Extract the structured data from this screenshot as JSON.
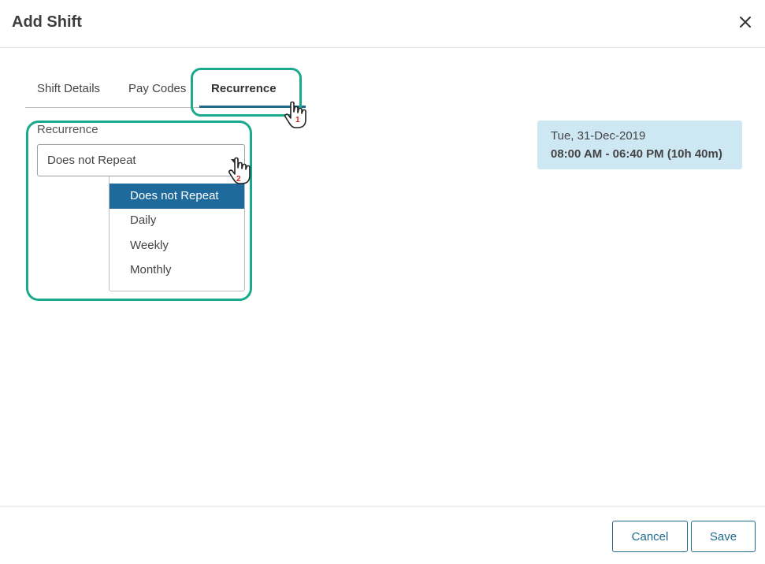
{
  "dialog": {
    "title": "Add Shift",
    "close_icon": "close-icon"
  },
  "tabs": [
    {
      "label": "Shift Details",
      "active": false
    },
    {
      "label": "Pay Codes",
      "active": false
    },
    {
      "label": "Recurrence",
      "active": true
    }
  ],
  "recurrence": {
    "label": "Recurrence",
    "selected_value": "Does not Repeat",
    "options": [
      "Does not Repeat",
      "Daily",
      "Weekly",
      "Monthly"
    ]
  },
  "shift_info": {
    "date": "Tue, 31-Dec-2019",
    "time": "08:00 AM - 06:40 PM (10h 40m)"
  },
  "annotations": {
    "step1": "1",
    "step2": "2",
    "highlight_color": "#1aa98a",
    "step_color": "#d0241c"
  },
  "footer": {
    "cancel_label": "Cancel",
    "save_label": "Save"
  },
  "colors": {
    "accent": "#1f6a8c",
    "selected_option_bg": "#1f6a9c",
    "info_bg": "#cde7f3"
  }
}
